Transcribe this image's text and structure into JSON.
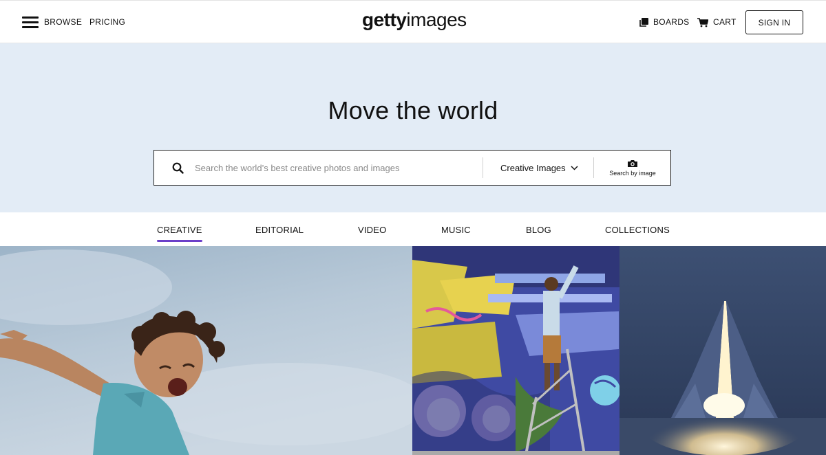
{
  "header": {
    "nav": [
      "BROWSE",
      "PRICING"
    ],
    "logo_bold": "getty",
    "logo_light": "images",
    "boards": "BOARDS",
    "cart": "CART",
    "signin": "SIGN IN"
  },
  "hero": {
    "title": "Move the world",
    "search": {
      "placeholder": "Search the world’s best creative photos and images",
      "value": "",
      "type_selected": "Creative Images",
      "search_by_image": "Search by image"
    }
  },
  "tabs": [
    "CREATIVE",
    "EDITORIAL",
    "VIDEO",
    "MUSIC",
    "BLOG",
    "COLLECTIONS"
  ],
  "active_tab": "CREATIVE",
  "colors": {
    "hero_bg": "#e3ecf6",
    "tab_underline": "#6b3fc9"
  },
  "icons": [
    "menu-icon",
    "boards-icon",
    "cart-icon",
    "search-icon",
    "chevron-down-icon",
    "camera-icon"
  ]
}
